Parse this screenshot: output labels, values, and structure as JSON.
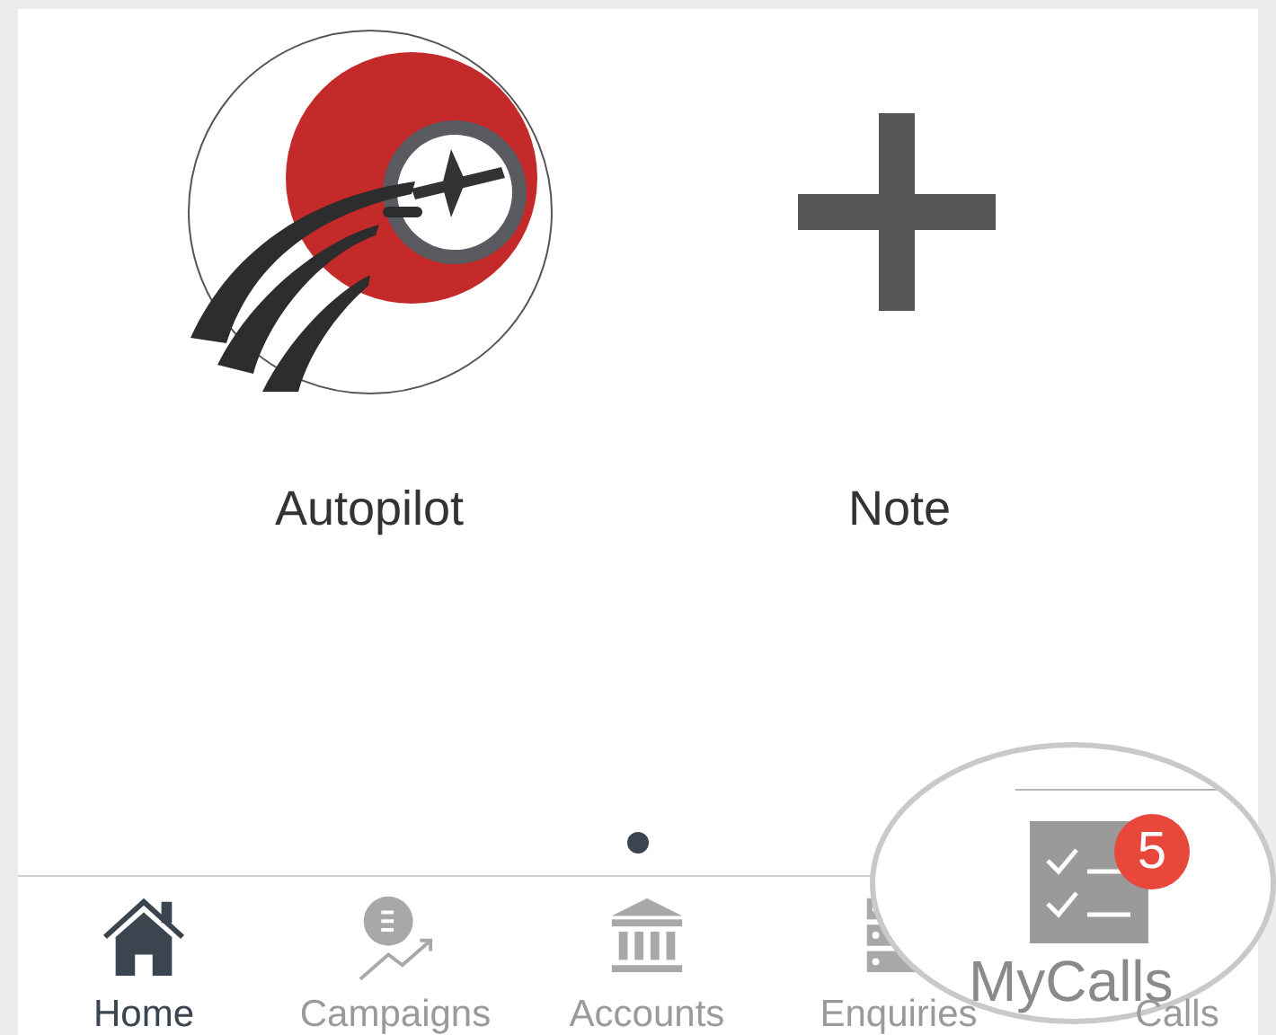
{
  "tiles": [
    {
      "kind": "autopilot",
      "label": "Autopilot"
    },
    {
      "kind": "plus",
      "label": "Note"
    }
  ],
  "tabs": [
    {
      "kind": "home",
      "label": "Home",
      "selected": true
    },
    {
      "kind": "campaigns",
      "label": "Campaigns",
      "selected": false
    },
    {
      "kind": "accounts",
      "label": "Accounts",
      "selected": false
    },
    {
      "kind": "enquiries",
      "label": "Enquiries",
      "selected": false
    },
    {
      "kind": "mycalls",
      "label": "Calls",
      "selected": false
    }
  ],
  "magnifier": {
    "label": "MyCalls",
    "badge": "5"
  }
}
